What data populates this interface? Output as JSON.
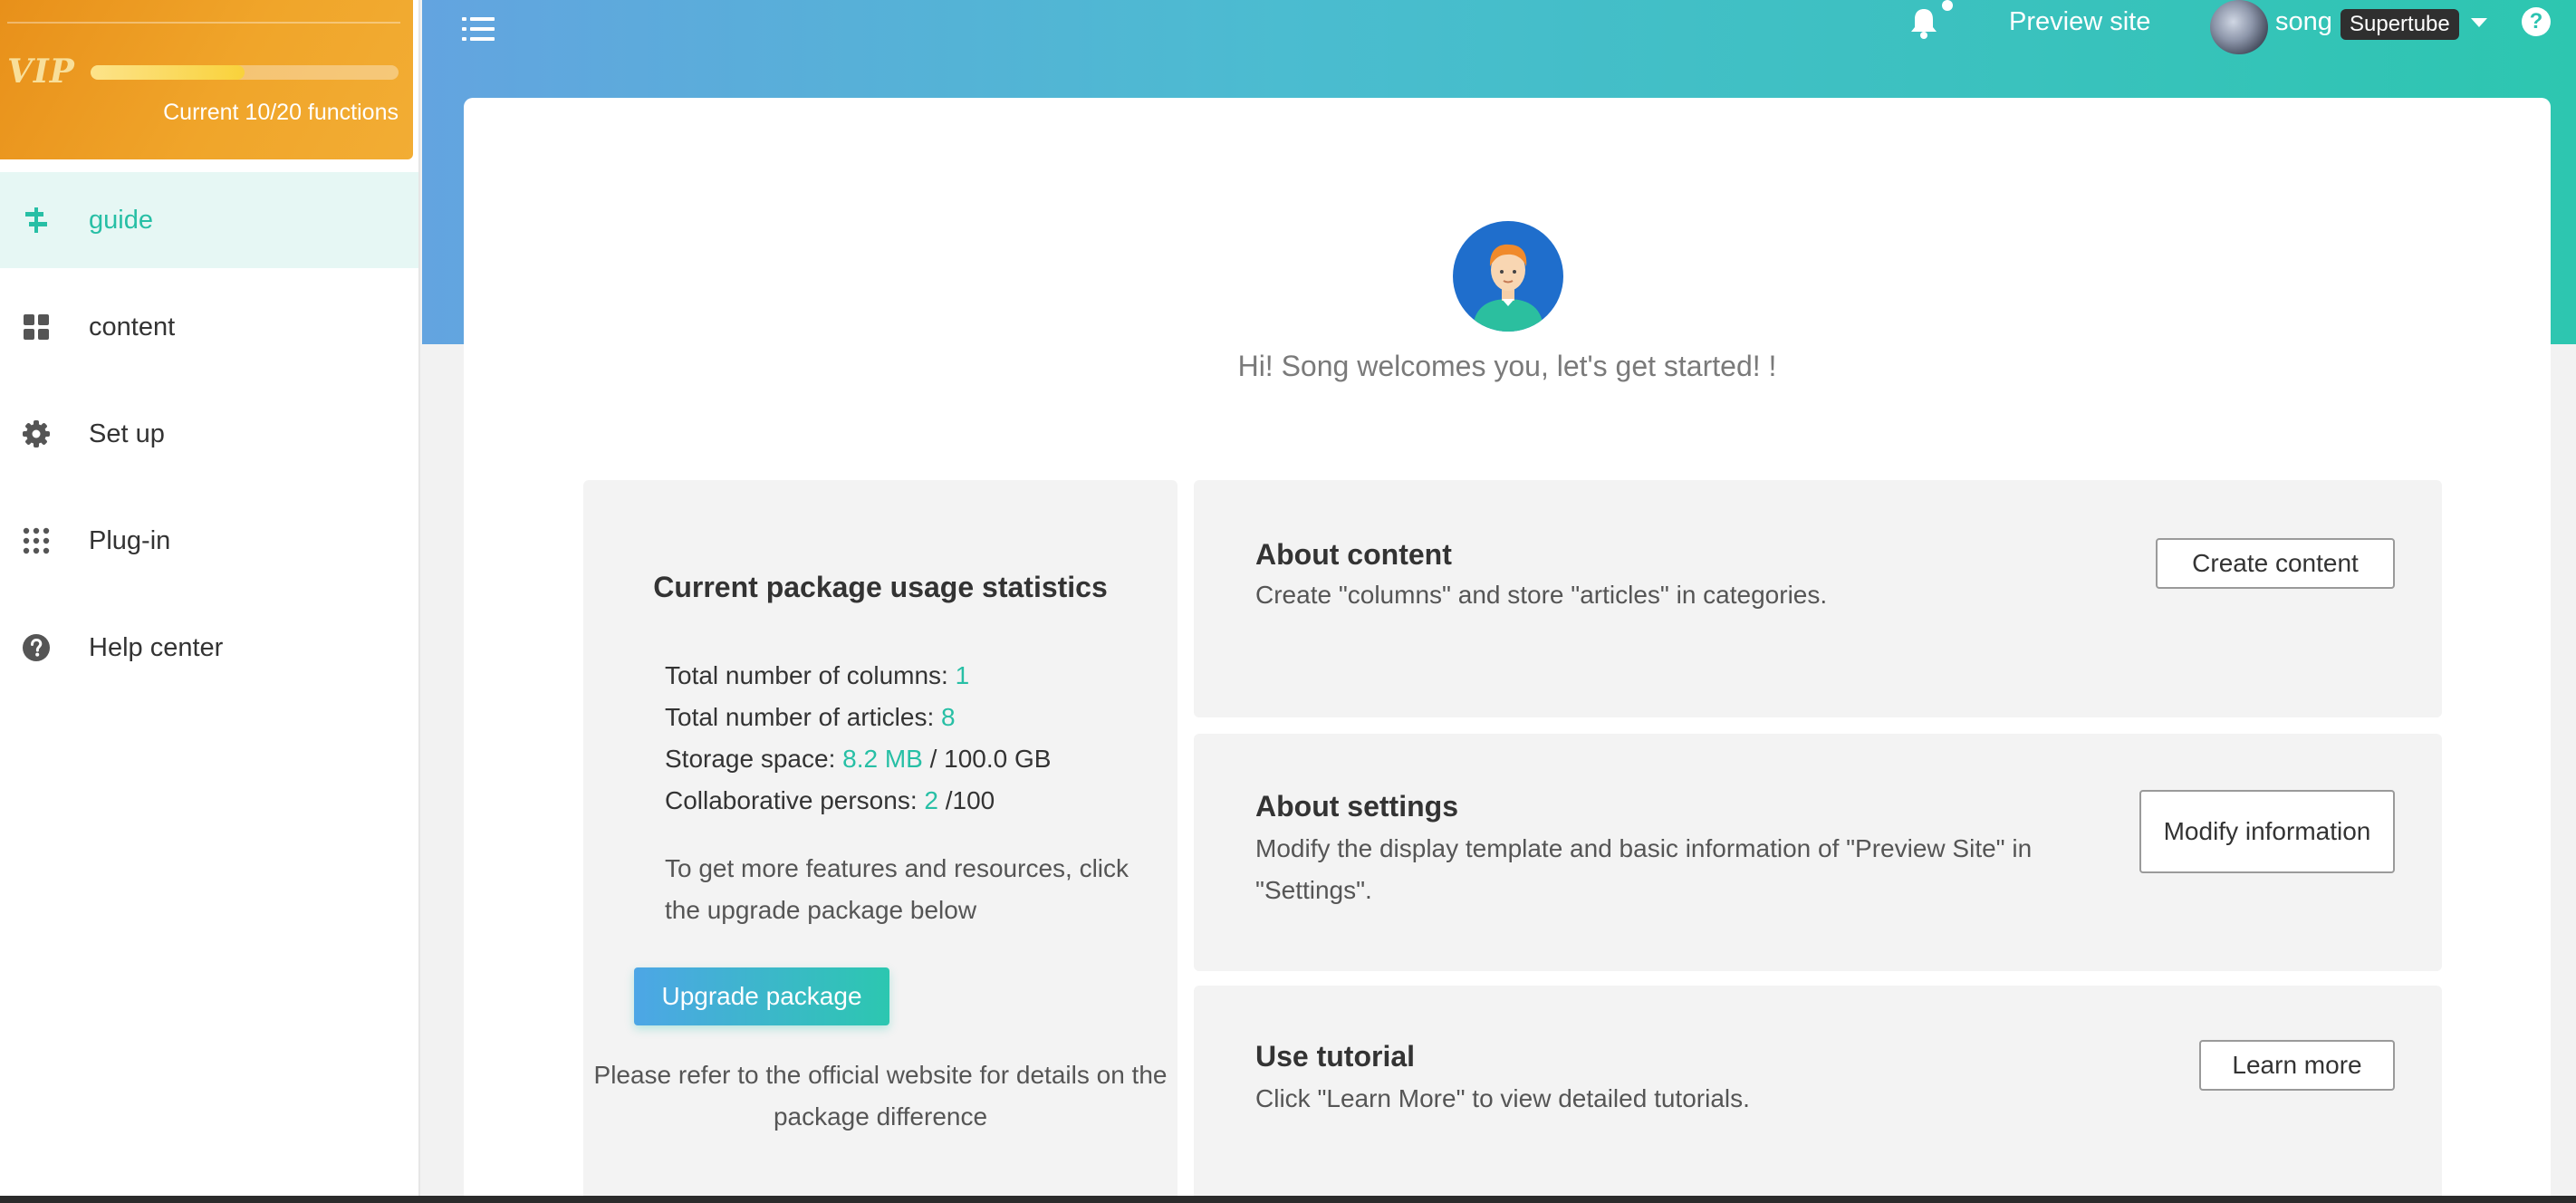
{
  "vip": {
    "logo": "VIP",
    "progress_fraction": 0.5,
    "label": "Current 10/20 functions"
  },
  "sidebar": {
    "items": [
      {
        "label": "guide",
        "icon": "signpost-icon",
        "active": true
      },
      {
        "label": "content",
        "icon": "grid-icon",
        "active": false
      },
      {
        "label": "Set up",
        "icon": "gear-icon",
        "active": false
      },
      {
        "label": "Plug-in",
        "icon": "dots-grid-icon",
        "active": false
      },
      {
        "label": "Help center",
        "icon": "question-circle-icon",
        "active": false
      }
    ]
  },
  "header": {
    "preview_label": "Preview site",
    "user_name": "song",
    "user_badge": "Supertube",
    "help_icon": "?"
  },
  "main": {
    "welcome": "Hi! Song welcomes you, let's get started! !",
    "stats": {
      "title": "Current package usage statistics",
      "columns_label": "Total number of columns: ",
      "columns_value": "1",
      "articles_label": "Total number of articles: ",
      "articles_value": "8",
      "storage_label": "Storage space: ",
      "storage_value": "8.2 MB",
      "storage_total": " / 100.0 GB",
      "collab_label": "Collaborative persons: ",
      "collab_value": "2",
      "collab_total": " /100",
      "note": "To get more features and resources, click the upgrade package below",
      "upgrade_button": "Upgrade package",
      "footer": "Please refer to the official website for details on the package difference"
    },
    "panels": [
      {
        "title": "About content",
        "desc": "Create \"columns\" and store \"articles\" in categories.",
        "button": "Create content"
      },
      {
        "title": "About settings",
        "desc": "Modify the display template and basic information of \"Preview Site\" in \"Settings\".",
        "button": "Modify information"
      },
      {
        "title": "Use tutorial",
        "desc": "Click \"Learn More\" to view detailed tutorials.",
        "button": "Learn more"
      }
    ]
  },
  "colors": {
    "accent": "#27bfa5",
    "vip_orange": "#ee9d24",
    "header_start": "#63a4e0",
    "header_end": "#2dc6b0"
  }
}
